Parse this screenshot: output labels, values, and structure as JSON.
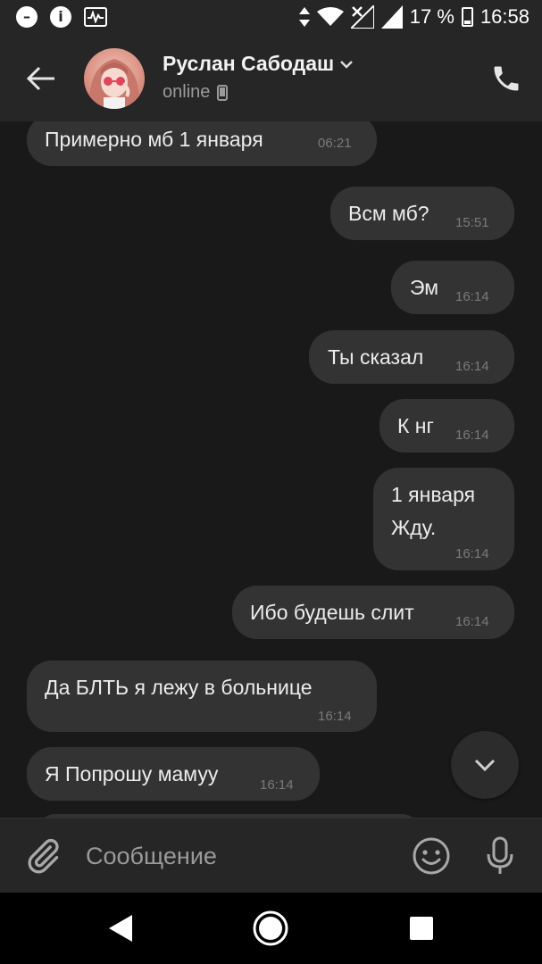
{
  "status_bar": {
    "battery_percent": "17 %",
    "time": "16:58",
    "icons": [
      "do-not-disturb-icon",
      "info-icon",
      "activity-icon",
      "data-arrows-icon",
      "wifi-icon",
      "no-signal-icon",
      "signal-icon",
      "battery-charging-icon"
    ]
  },
  "header": {
    "contact_name": "Руслан Сабодаш",
    "status": "online"
  },
  "messages": [
    {
      "text": "Примерно мб 1 января",
      "time": "06:21",
      "direction": "in"
    },
    {
      "text": "Всм мб?",
      "time": "15:51",
      "direction": "out"
    },
    {
      "text": "Эм",
      "time": "16:14",
      "direction": "out"
    },
    {
      "text": "Ты сказал",
      "time": "16:14",
      "direction": "out"
    },
    {
      "text": "К нг",
      "time": "16:14",
      "direction": "out"
    },
    {
      "text_line1": "1 января",
      "text_line2": "Жду.",
      "time": "16:14",
      "direction": "out"
    },
    {
      "text": "Ибо будешь слит",
      "time": "16:14",
      "direction": "out"
    },
    {
      "text": "Да БЛТЬ я лежу в больнице",
      "time": "16:14",
      "direction": "in"
    },
    {
      "text": "Я Попрошу мамуу",
      "time": "16:14",
      "direction": "in"
    }
  ],
  "composer": {
    "placeholder": "Сообщение"
  },
  "colors": {
    "background": "#191919",
    "header": "#262626",
    "bubble": "#333333",
    "text": "#ececec",
    "secondary": "#9a9a9a"
  }
}
